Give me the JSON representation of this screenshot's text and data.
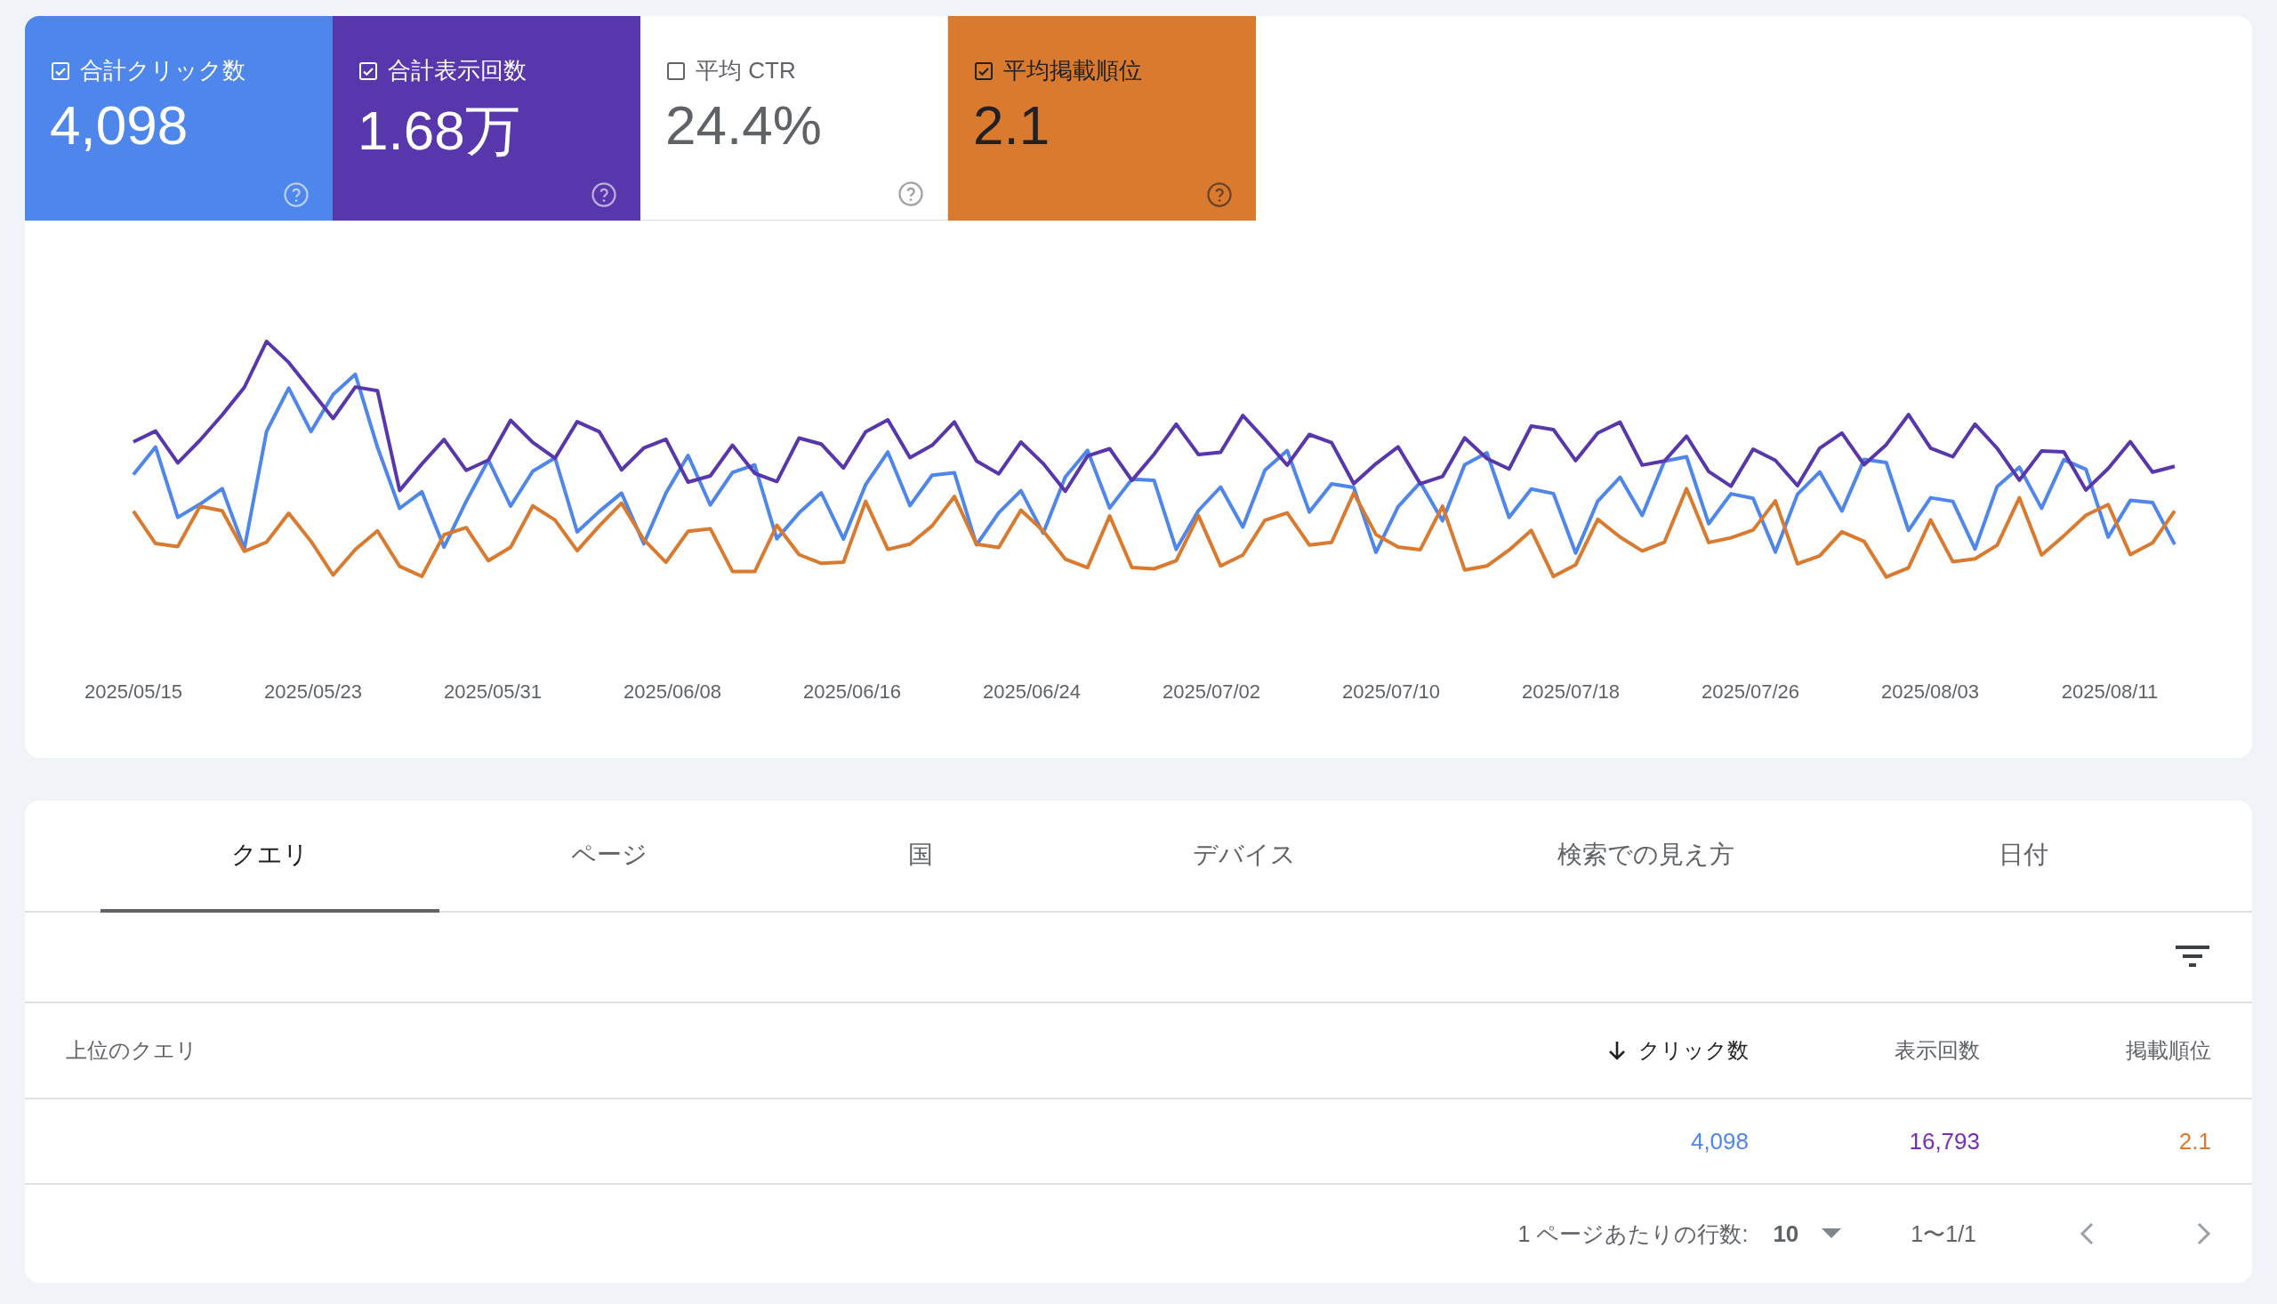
{
  "metrics": [
    {
      "label": "合計クリック数",
      "value": "4,098",
      "checked": true,
      "color": "#4e86ec"
    },
    {
      "label": "合計表示回数",
      "value": "1.68万",
      "checked": true,
      "color": "#5836ab"
    },
    {
      "label": "平均 CTR",
      "value": "24.4%",
      "checked": false
    },
    {
      "label": "平均掲載順位",
      "value": "2.1",
      "checked": true,
      "color": "#d97a2f"
    }
  ],
  "chart": {
    "x_labels": [
      "2025/05/15",
      "2025/05/23",
      "2025/05/31",
      "2025/06/08",
      "2025/06/16",
      "2025/06/24",
      "2025/07/02",
      "2025/07/10",
      "2025/07/18",
      "2025/07/26",
      "2025/08/03",
      "2025/08/11"
    ]
  },
  "tabs": [
    {
      "label": "クエリ",
      "selected": true
    },
    {
      "label": "ページ",
      "selected": false
    },
    {
      "label": "国",
      "selected": false
    },
    {
      "label": "デバイス",
      "selected": false
    },
    {
      "label": "検索での見え方",
      "selected": false
    },
    {
      "label": "日付",
      "selected": false
    }
  ],
  "table": {
    "columns": [
      {
        "label": "上位のクエリ",
        "sorted": false
      },
      {
        "label": "クリック数",
        "sorted": true,
        "color": "#4e86ec"
      },
      {
        "label": "表示回数",
        "sorted": false,
        "color": "#7b2cb5"
      },
      {
        "label": "掲載順位",
        "sorted": false,
        "color": "#d97a2f"
      }
    ],
    "rows": [
      {
        "cells": [
          "",
          "4,098",
          "16,793",
          "2.1"
        ]
      }
    ]
  },
  "pagination": {
    "rows_per_page_label": "1 ページあたりの行数:",
    "rows_per_page": "10",
    "range": "1〜1/1"
  }
}
